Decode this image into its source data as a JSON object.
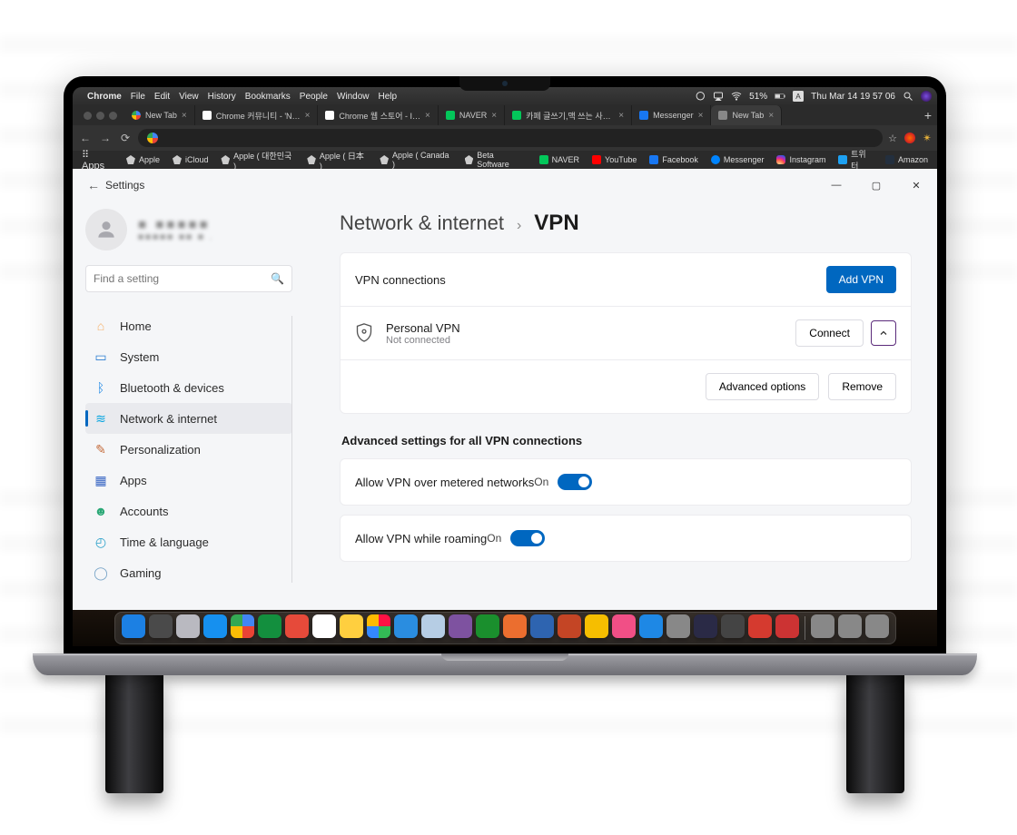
{
  "mac_menu": {
    "app": "Chrome",
    "items": [
      "File",
      "Edit",
      "View",
      "History",
      "Bookmarks",
      "People",
      "Window",
      "Help"
    ],
    "battery": "51%",
    "clock": "Thu Mar 14  19 57 06"
  },
  "tabs": [
    {
      "title": "New Tab",
      "fav": "g",
      "active": false
    },
    {
      "title": "Chrome 커뮤니티 - 'N…",
      "fav": "c",
      "active": false
    },
    {
      "title": "Chrome 웹 스토어 - I…",
      "fav": "c",
      "active": false
    },
    {
      "title": "NAVER",
      "fav": "n",
      "active": false
    },
    {
      "title": "카페 글쓰기,맥 쓰는 사람…",
      "fav": "n",
      "active": false
    },
    {
      "title": "Messenger",
      "fav": "fb",
      "active": false
    },
    {
      "title": "New Tab",
      "fav": "",
      "active": true
    }
  ],
  "bookmarks": [
    {
      "label": "Apps",
      "ico": ""
    },
    {
      "label": "Apple",
      "ico": "apple"
    },
    {
      "label": "iCloud",
      "ico": "apple"
    },
    {
      "label": "Apple ( 대한민국 )",
      "ico": "apple"
    },
    {
      "label": "Apple ( 日本 )",
      "ico": "apple"
    },
    {
      "label": "Apple ( Canada )",
      "ico": "apple"
    },
    {
      "label": "Beta Software",
      "ico": "apple"
    },
    {
      "label": "NAVER",
      "ico": "n"
    },
    {
      "label": "YouTube",
      "ico": "yt"
    },
    {
      "label": "Facebook",
      "ico": "fb"
    },
    {
      "label": "Messenger",
      "ico": "msg"
    },
    {
      "label": "Instagram",
      "ico": "ig"
    },
    {
      "label": "트위터",
      "ico": "tw"
    },
    {
      "label": "Amazon",
      "ico": "am"
    }
  ],
  "settings": {
    "window_title": "Settings",
    "search_placeholder": "Find a setting",
    "nav": [
      {
        "label": "Home",
        "color": "#f6b26b",
        "glyph": "⌂"
      },
      {
        "label": "System",
        "color": "#2a7dd1",
        "glyph": "▭"
      },
      {
        "label": "Bluetooth & devices",
        "color": "#1e88e5",
        "glyph": "ᛒ"
      },
      {
        "label": "Network & internet",
        "color": "#00a3e0",
        "glyph": "≋",
        "active": true
      },
      {
        "label": "Personalization",
        "color": "#c46a3a",
        "glyph": "✎"
      },
      {
        "label": "Apps",
        "color": "#3a67c4",
        "glyph": "▦"
      },
      {
        "label": "Accounts",
        "color": "#2aa876",
        "glyph": "☻"
      },
      {
        "label": "Time & language",
        "color": "#2aa0c9",
        "glyph": "◴"
      },
      {
        "label": "Gaming",
        "color": "#7da7c9",
        "glyph": "◯"
      }
    ],
    "breadcrumb_parent": "Network & internet",
    "breadcrumb_child": "VPN",
    "vpn_connections_label": "VPN connections",
    "add_vpn": "Add VPN",
    "vpn": {
      "name": "Personal VPN",
      "status": "Not connected",
      "connect": "Connect"
    },
    "advanced_options": "Advanced options",
    "remove": "Remove",
    "advanced_heading": "Advanced settings for all VPN connections",
    "settings_list": [
      {
        "label": "Allow VPN over metered networks",
        "state": "On"
      },
      {
        "label": "Allow VPN while roaming",
        "state": "On"
      }
    ]
  },
  "dock_icons": [
    "#1c80e3",
    "#4a4a4a",
    "#b9b9c0",
    "#1690ef",
    "conic",
    "#138f3e",
    "#e64a3a",
    "#fff",
    "#ffcf3f",
    "multi",
    "#2a8de0",
    "#b6cde4",
    "#7e52a0",
    "#1a8f2d",
    "#eb6e2f",
    "#2e64b0",
    "#c44525",
    "#f6be00",
    "#f14f86",
    "#1e88e5",
    "#888",
    "#2a2a46",
    "#444",
    "#d53a2f",
    "#c33",
    "#888",
    "#888",
    "#888"
  ]
}
